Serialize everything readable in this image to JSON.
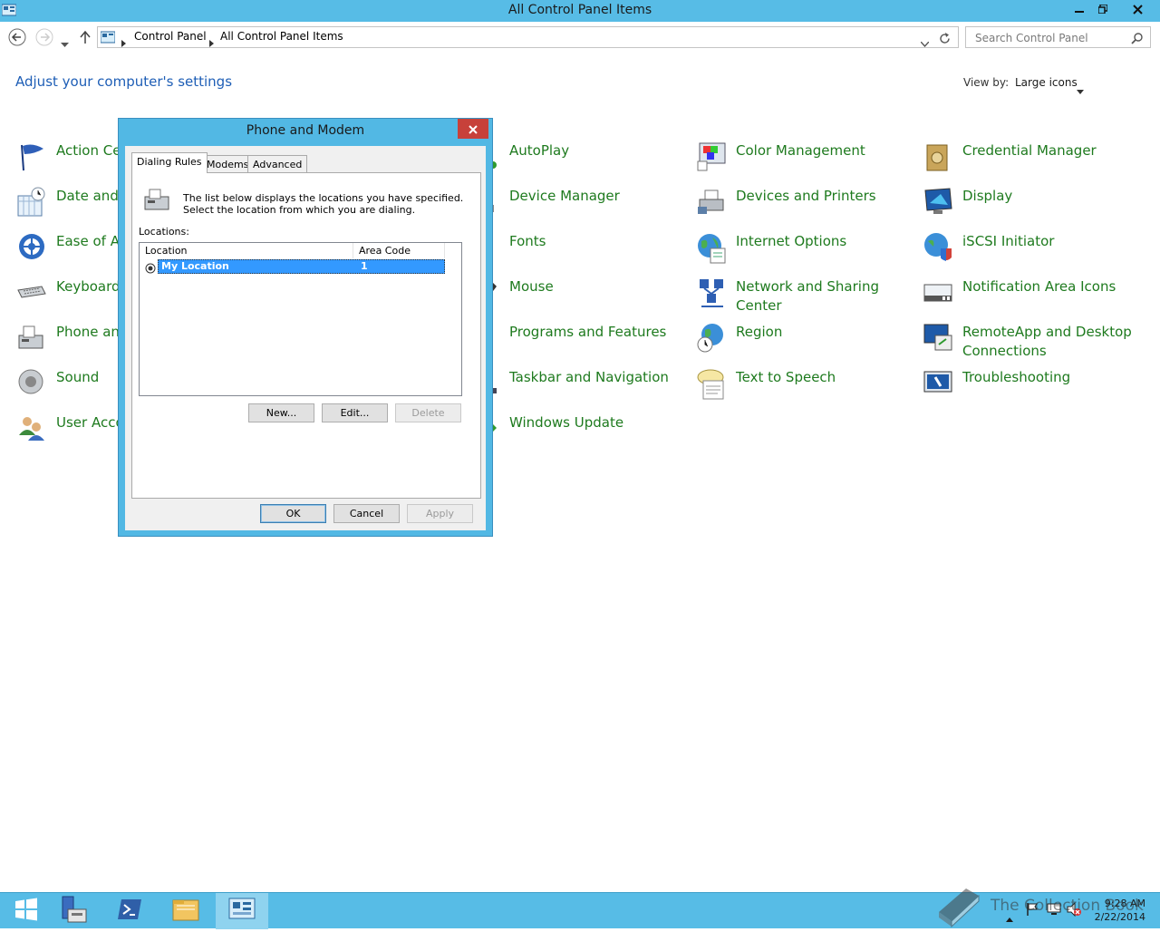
{
  "window": {
    "title": "All Control Panel Items"
  },
  "address": {
    "crumbs": [
      "Control Panel",
      "All Control Panel Items"
    ],
    "search_placeholder": "Search Control Panel"
  },
  "header": {
    "title": "Adjust your computer's settings",
    "view_by_label": "View by:",
    "view_by_value": "Large icons"
  },
  "items": {
    "col1": [
      "Action Ce",
      "Date and T",
      "Ease of Ac",
      "Keyboard",
      "Phone and",
      "Sound",
      "User Acco"
    ],
    "col2": [
      "AutoPlay",
      "Device Manager",
      "Fonts",
      "Mouse",
      "Programs and Features",
      "Taskbar and Navigation",
      "Windows Update"
    ],
    "col3": [
      "Color Management",
      "Devices and Printers",
      "Internet Options",
      "Network and Sharing Center",
      "Region",
      "Text to Speech"
    ],
    "col4": [
      "Credential Manager",
      "Display",
      "iSCSI Initiator",
      "Notification Area Icons",
      "RemoteApp and Desktop Connections",
      "Troubleshooting"
    ]
  },
  "dialog": {
    "title": "Phone and Modem",
    "tabs": [
      "Dialing Rules",
      "Modems",
      "Advanced"
    ],
    "description": "The list below displays the locations you have specified. Select the location from which you are dialing.",
    "locations_label": "Locations:",
    "columns": [
      "Location",
      "Area Code"
    ],
    "rows": [
      {
        "location": "My Location",
        "area_code": "1"
      }
    ],
    "buttons": {
      "new": "New...",
      "edit": "Edit...",
      "delete": "Delete",
      "ok": "OK",
      "cancel": "Cancel",
      "apply": "Apply"
    }
  },
  "taskbar": {
    "time": "9:28 AM",
    "date": "2/22/2014",
    "watermark": "The Collection Book"
  },
  "colors": {
    "titlebar": "#57bce6",
    "link_green": "#1e7a1e",
    "link_blue": "#1e5eb6",
    "selection": "#3399ff"
  }
}
